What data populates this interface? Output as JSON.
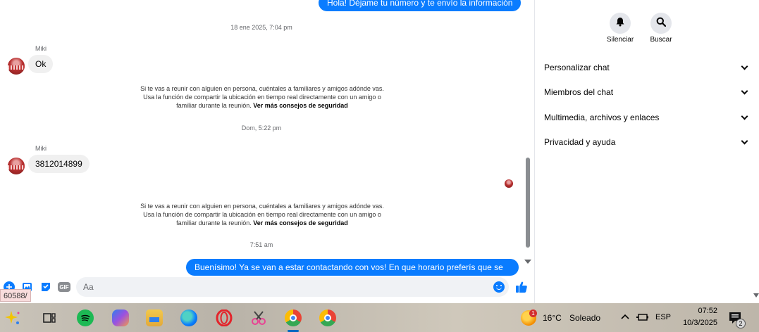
{
  "chat": {
    "top_outgoing": "Hola! Déjame tu número y te envío la información",
    "timestamp_1": "18 ene 2025, 7:04 pm",
    "sender_1": "Miki",
    "message_1": "Ok",
    "safety_notice_text": "Si te vas a reunir con alguien en persona, cuéntales a familiares y amigos adónde vas. Usa la función de compartir la ubicación en tiempo real directamente con un amigo o familiar durante la reunión.",
    "safety_notice_link": "Ver más consejos de seguridad",
    "timestamp_2": "Dom, 5:22 pm",
    "sender_2": "Miki",
    "message_2": "3812014899",
    "timestamp_3": "7:51 am",
    "bottom_outgoing": "Buenísimo! Ya se van a estar contactando con vos! En que horario preferís que se"
  },
  "composer": {
    "placeholder": "Aa",
    "gif_label": "GIF"
  },
  "url_status": "60588/",
  "panel": {
    "mute_label": "Silenciar",
    "search_label": "Buscar",
    "sections": [
      {
        "label": "Personalizar chat"
      },
      {
        "label": "Miembros del chat"
      },
      {
        "label": "Multimedia, archivos y enlaces"
      },
      {
        "label": "Privacidad y ayuda"
      }
    ]
  },
  "taskbar": {
    "weather_temp": "16°C",
    "weather_desc": "Soleado",
    "language": "ESP",
    "time": "07:52",
    "date": "10/3/2025",
    "notification_count": "2",
    "weather_badge": "1"
  },
  "colors": {
    "accent": "#0a7cff",
    "bubble_in": "#f0f0f0",
    "muted_text": "#65676b"
  }
}
